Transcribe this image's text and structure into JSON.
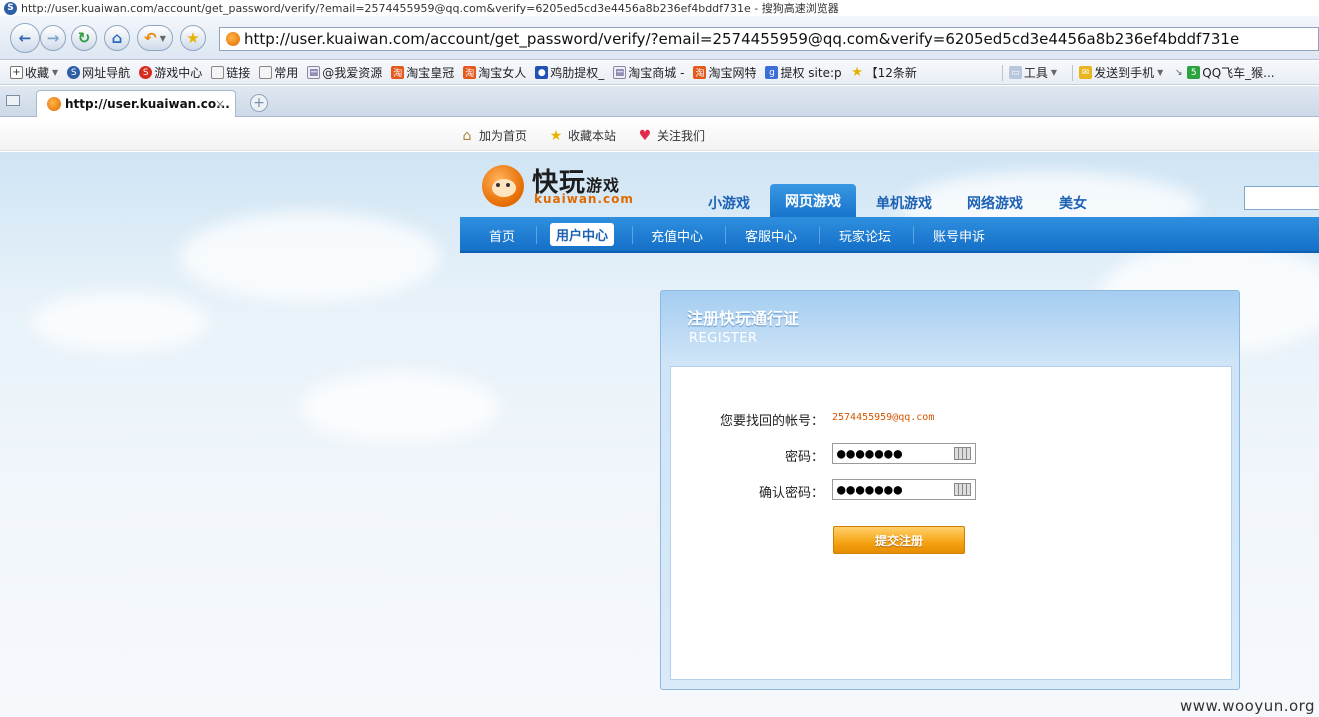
{
  "window": {
    "title": "http://user.kuaiwan.com/account/get_password/verify/?email=2574455959@qq.com&verify=6205ed5cd3e4456a8b236ef4bddf731e - 搜狗高速浏览器"
  },
  "browser": {
    "address": "http://user.kuaiwan.com/account/get_password/verify/?email=2574455959@qq.com&verify=6205ed5cd3e4456a8b236ef4bddf731e",
    "bookmarks": [
      {
        "label": "收藏",
        "icon": "plus-icon"
      },
      {
        "label": "网址导航",
        "icon": "sogou-icon"
      },
      {
        "label": "游戏中心",
        "icon": "game-icon"
      },
      {
        "label": "链接",
        "icon": "folder-icon"
      },
      {
        "label": "常用",
        "icon": "folder-icon"
      },
      {
        "label": "@我爱资源",
        "icon": "page-icon"
      },
      {
        "label": "淘宝皇冠",
        "icon": "taobao-icon"
      },
      {
        "label": "淘宝女人",
        "icon": "taobao-icon"
      },
      {
        "label": "鸡肋提权_",
        "icon": "baidu-paw-icon"
      },
      {
        "label": "淘宝商城 -",
        "icon": "page-icon"
      },
      {
        "label": "淘宝网特",
        "icon": "taobao-icon"
      },
      {
        "label": "提权 site:p",
        "icon": "google-icon"
      },
      {
        "label": "【12条新",
        "icon": "star-icon"
      }
    ],
    "tools_label": "工具",
    "send_phone_label": "发送到手机",
    "qq_label": "QQ飞车_猴...",
    "tab_title": "http://user.kuaiwan.co...",
    "tab_close": "×",
    "new_tab": "+"
  },
  "site": {
    "toplinks": {
      "home": "加为首页",
      "favorite": "收藏本站",
      "follow": "关注我们"
    },
    "logo": {
      "cn_main": "快玩",
      "cn_small": "游戏",
      "en": "kuaiwan.com"
    },
    "main_tabs": [
      "小游戏",
      "网页游戏",
      "单机游戏",
      "网络游戏",
      "美女"
    ],
    "sub_nav": [
      "首页",
      "用户中心",
      "充值中心",
      "客服中心",
      "玩家论坛",
      "账号申诉"
    ],
    "panel": {
      "title": "注册快玩通行证",
      "subtitle": "REGISTER",
      "account_label": "您要找回的帐号：",
      "account_value": "2574455959@qq.com",
      "password_label": "密码：",
      "password_value": "●●●●●●●",
      "confirm_label": "确认密码：",
      "confirm_value": "●●●●●●●",
      "submit": "提交注册"
    }
  },
  "watermark": "www.wooyun.org",
  "colors": {
    "accent_blue": "#1874cc",
    "account_orange": "#d45500",
    "button_orange": "#f5a313"
  }
}
